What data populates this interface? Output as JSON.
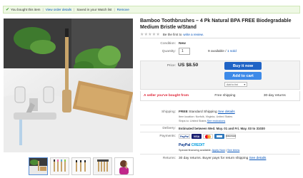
{
  "banner": {
    "check": "✔",
    "text": "You bought this item",
    "sep1": "|",
    "order_details": "View order details",
    "sep2": "|",
    "saved": "Saved in your Watch list",
    "sep3": "|",
    "remove": "Remove"
  },
  "product": {
    "title": "Bamboo Toothbrushes – 4 Pk Natural BPA FREE Biodegradable Medium Bristle w/Stand",
    "stars": "★★★★★",
    "first_review_prefix": "Be the first to",
    "first_review_link": "write a review."
  },
  "details": {
    "condition_label": "Condition:",
    "condition_value": "New",
    "quantity_label": "Quantity:",
    "quantity_value": "1",
    "available_text": "9 available",
    "sold_sep": "/",
    "sold_link": "1 sold"
  },
  "price": {
    "label": "Price:",
    "value": "US $8.50",
    "buy_now": "Buy it now",
    "add_to_cart": "Add to cart",
    "watch": "Add to list",
    "watch_caret": "▼"
  },
  "seller_bar": {
    "bought_from": "A seller you've bought from",
    "shipping": "Free shipping",
    "returns": "30-day returns"
  },
  "shipping": {
    "label": "Shipping:",
    "free": "FREE",
    "method": "Standard Shipping",
    "see_details": "See details",
    "item_location": "Item location: Norfolk, Virginia, United States",
    "ships_to_prefix": "Ships to: United States",
    "ships_to_link": "See exclusions"
  },
  "delivery": {
    "label": "Delivery:",
    "text": "Estimated between Wed. May. 01 and Fri. May. 03 to 31030"
  },
  "payments": {
    "label": "Payments:",
    "paypal": "PayPal",
    "visa": "VISA",
    "discover": "DISCOVER",
    "credit_paypal": "PayPal",
    "credit_text": "CREDIT",
    "special_financing": "Special financing available.",
    "apply_now": "Apply Now",
    "sep": "|",
    "see_terms": "See terms"
  },
  "returns": {
    "label": "Returns:",
    "text": "30 day returns. Buyer pays for return shipping",
    "see_details": "See details"
  },
  "colors": {
    "accent_blue": "#0654ba",
    "buy_blue": "#1f63c5",
    "cart_blue": "#3d8ae8",
    "seller_red": "#dd1e31",
    "banner_green": "#eef8e4"
  }
}
